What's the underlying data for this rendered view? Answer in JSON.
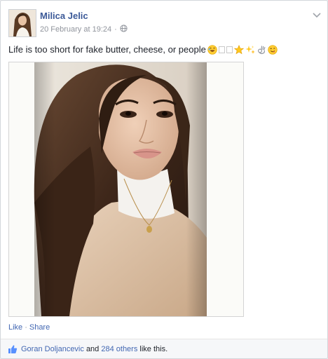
{
  "post": {
    "author": "Milica Jelic",
    "timestamp": "20 February at 19:24",
    "separator": "·",
    "privacy_icon": "globe-icon",
    "menu_icon": "chevron-down-icon",
    "text": "Life is too short for fake butter, cheese, or people",
    "emojis": [
      "laughing-face-icon",
      "blank-glyph",
      "blank-glyph",
      "star-icon",
      "sparkles-icon",
      "ok-hand-icon",
      "winking-face-icon"
    ]
  },
  "actions": {
    "like": "Like",
    "separator": "·",
    "share": "Share"
  },
  "likes": {
    "icon": "thumbs-up-icon",
    "name": "Goran Doljancevic",
    "and": "and",
    "others": "284 others",
    "suffix": "like this."
  },
  "colors": {
    "link": "#3b5998",
    "link_alt": "#4267b2",
    "meta": "#90949c",
    "text": "#1d2129",
    "footer_bg": "#f6f7f9"
  }
}
